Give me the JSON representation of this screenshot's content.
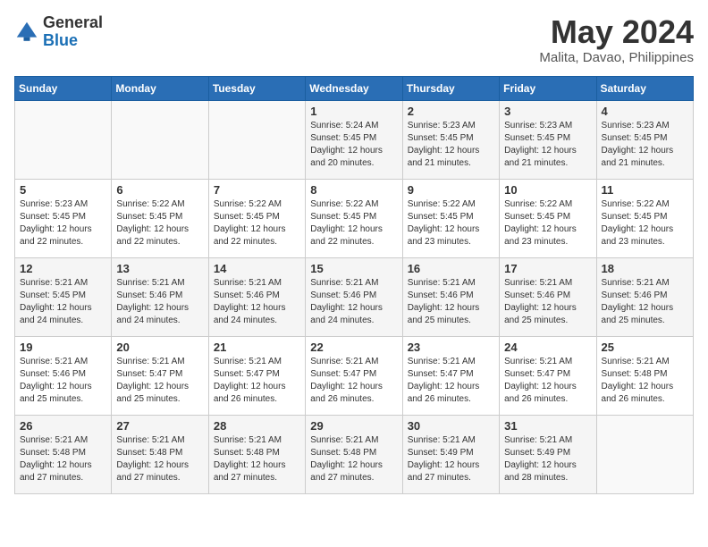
{
  "logo": {
    "general": "General",
    "blue": "Blue"
  },
  "title": {
    "month_year": "May 2024",
    "location": "Malita, Davao, Philippines"
  },
  "weekdays": [
    "Sunday",
    "Monday",
    "Tuesday",
    "Wednesday",
    "Thursday",
    "Friday",
    "Saturday"
  ],
  "weeks": [
    [
      {
        "day": "",
        "sunrise": "",
        "sunset": "",
        "daylight": ""
      },
      {
        "day": "",
        "sunrise": "",
        "sunset": "",
        "daylight": ""
      },
      {
        "day": "",
        "sunrise": "",
        "sunset": "",
        "daylight": ""
      },
      {
        "day": "1",
        "sunrise": "Sunrise: 5:24 AM",
        "sunset": "Sunset: 5:45 PM",
        "daylight": "Daylight: 12 hours and 20 minutes."
      },
      {
        "day": "2",
        "sunrise": "Sunrise: 5:23 AM",
        "sunset": "Sunset: 5:45 PM",
        "daylight": "Daylight: 12 hours and 21 minutes."
      },
      {
        "day": "3",
        "sunrise": "Sunrise: 5:23 AM",
        "sunset": "Sunset: 5:45 PM",
        "daylight": "Daylight: 12 hours and 21 minutes."
      },
      {
        "day": "4",
        "sunrise": "Sunrise: 5:23 AM",
        "sunset": "Sunset: 5:45 PM",
        "daylight": "Daylight: 12 hours and 21 minutes."
      }
    ],
    [
      {
        "day": "5",
        "sunrise": "Sunrise: 5:23 AM",
        "sunset": "Sunset: 5:45 PM",
        "daylight": "Daylight: 12 hours and 22 minutes."
      },
      {
        "day": "6",
        "sunrise": "Sunrise: 5:22 AM",
        "sunset": "Sunset: 5:45 PM",
        "daylight": "Daylight: 12 hours and 22 minutes."
      },
      {
        "day": "7",
        "sunrise": "Sunrise: 5:22 AM",
        "sunset": "Sunset: 5:45 PM",
        "daylight": "Daylight: 12 hours and 22 minutes."
      },
      {
        "day": "8",
        "sunrise": "Sunrise: 5:22 AM",
        "sunset": "Sunset: 5:45 PM",
        "daylight": "Daylight: 12 hours and 22 minutes."
      },
      {
        "day": "9",
        "sunrise": "Sunrise: 5:22 AM",
        "sunset": "Sunset: 5:45 PM",
        "daylight": "Daylight: 12 hours and 23 minutes."
      },
      {
        "day": "10",
        "sunrise": "Sunrise: 5:22 AM",
        "sunset": "Sunset: 5:45 PM",
        "daylight": "Daylight: 12 hours and 23 minutes."
      },
      {
        "day": "11",
        "sunrise": "Sunrise: 5:22 AM",
        "sunset": "Sunset: 5:45 PM",
        "daylight": "Daylight: 12 hours and 23 minutes."
      }
    ],
    [
      {
        "day": "12",
        "sunrise": "Sunrise: 5:21 AM",
        "sunset": "Sunset: 5:45 PM",
        "daylight": "Daylight: 12 hours and 24 minutes."
      },
      {
        "day": "13",
        "sunrise": "Sunrise: 5:21 AM",
        "sunset": "Sunset: 5:46 PM",
        "daylight": "Daylight: 12 hours and 24 minutes."
      },
      {
        "day": "14",
        "sunrise": "Sunrise: 5:21 AM",
        "sunset": "Sunset: 5:46 PM",
        "daylight": "Daylight: 12 hours and 24 minutes."
      },
      {
        "day": "15",
        "sunrise": "Sunrise: 5:21 AM",
        "sunset": "Sunset: 5:46 PM",
        "daylight": "Daylight: 12 hours and 24 minutes."
      },
      {
        "day": "16",
        "sunrise": "Sunrise: 5:21 AM",
        "sunset": "Sunset: 5:46 PM",
        "daylight": "Daylight: 12 hours and 25 minutes."
      },
      {
        "day": "17",
        "sunrise": "Sunrise: 5:21 AM",
        "sunset": "Sunset: 5:46 PM",
        "daylight": "Daylight: 12 hours and 25 minutes."
      },
      {
        "day": "18",
        "sunrise": "Sunrise: 5:21 AM",
        "sunset": "Sunset: 5:46 PM",
        "daylight": "Daylight: 12 hours and 25 minutes."
      }
    ],
    [
      {
        "day": "19",
        "sunrise": "Sunrise: 5:21 AM",
        "sunset": "Sunset: 5:46 PM",
        "daylight": "Daylight: 12 hours and 25 minutes."
      },
      {
        "day": "20",
        "sunrise": "Sunrise: 5:21 AM",
        "sunset": "Sunset: 5:47 PM",
        "daylight": "Daylight: 12 hours and 25 minutes."
      },
      {
        "day": "21",
        "sunrise": "Sunrise: 5:21 AM",
        "sunset": "Sunset: 5:47 PM",
        "daylight": "Daylight: 12 hours and 26 minutes."
      },
      {
        "day": "22",
        "sunrise": "Sunrise: 5:21 AM",
        "sunset": "Sunset: 5:47 PM",
        "daylight": "Daylight: 12 hours and 26 minutes."
      },
      {
        "day": "23",
        "sunrise": "Sunrise: 5:21 AM",
        "sunset": "Sunset: 5:47 PM",
        "daylight": "Daylight: 12 hours and 26 minutes."
      },
      {
        "day": "24",
        "sunrise": "Sunrise: 5:21 AM",
        "sunset": "Sunset: 5:47 PM",
        "daylight": "Daylight: 12 hours and 26 minutes."
      },
      {
        "day": "25",
        "sunrise": "Sunrise: 5:21 AM",
        "sunset": "Sunset: 5:48 PM",
        "daylight": "Daylight: 12 hours and 26 minutes."
      }
    ],
    [
      {
        "day": "26",
        "sunrise": "Sunrise: 5:21 AM",
        "sunset": "Sunset: 5:48 PM",
        "daylight": "Daylight: 12 hours and 27 minutes."
      },
      {
        "day": "27",
        "sunrise": "Sunrise: 5:21 AM",
        "sunset": "Sunset: 5:48 PM",
        "daylight": "Daylight: 12 hours and 27 minutes."
      },
      {
        "day": "28",
        "sunrise": "Sunrise: 5:21 AM",
        "sunset": "Sunset: 5:48 PM",
        "daylight": "Daylight: 12 hours and 27 minutes."
      },
      {
        "day": "29",
        "sunrise": "Sunrise: 5:21 AM",
        "sunset": "Sunset: 5:48 PM",
        "daylight": "Daylight: 12 hours and 27 minutes."
      },
      {
        "day": "30",
        "sunrise": "Sunrise: 5:21 AM",
        "sunset": "Sunset: 5:49 PM",
        "daylight": "Daylight: 12 hours and 27 minutes."
      },
      {
        "day": "31",
        "sunrise": "Sunrise: 5:21 AM",
        "sunset": "Sunset: 5:49 PM",
        "daylight": "Daylight: 12 hours and 28 minutes."
      },
      {
        "day": "",
        "sunrise": "",
        "sunset": "",
        "daylight": ""
      }
    ]
  ]
}
